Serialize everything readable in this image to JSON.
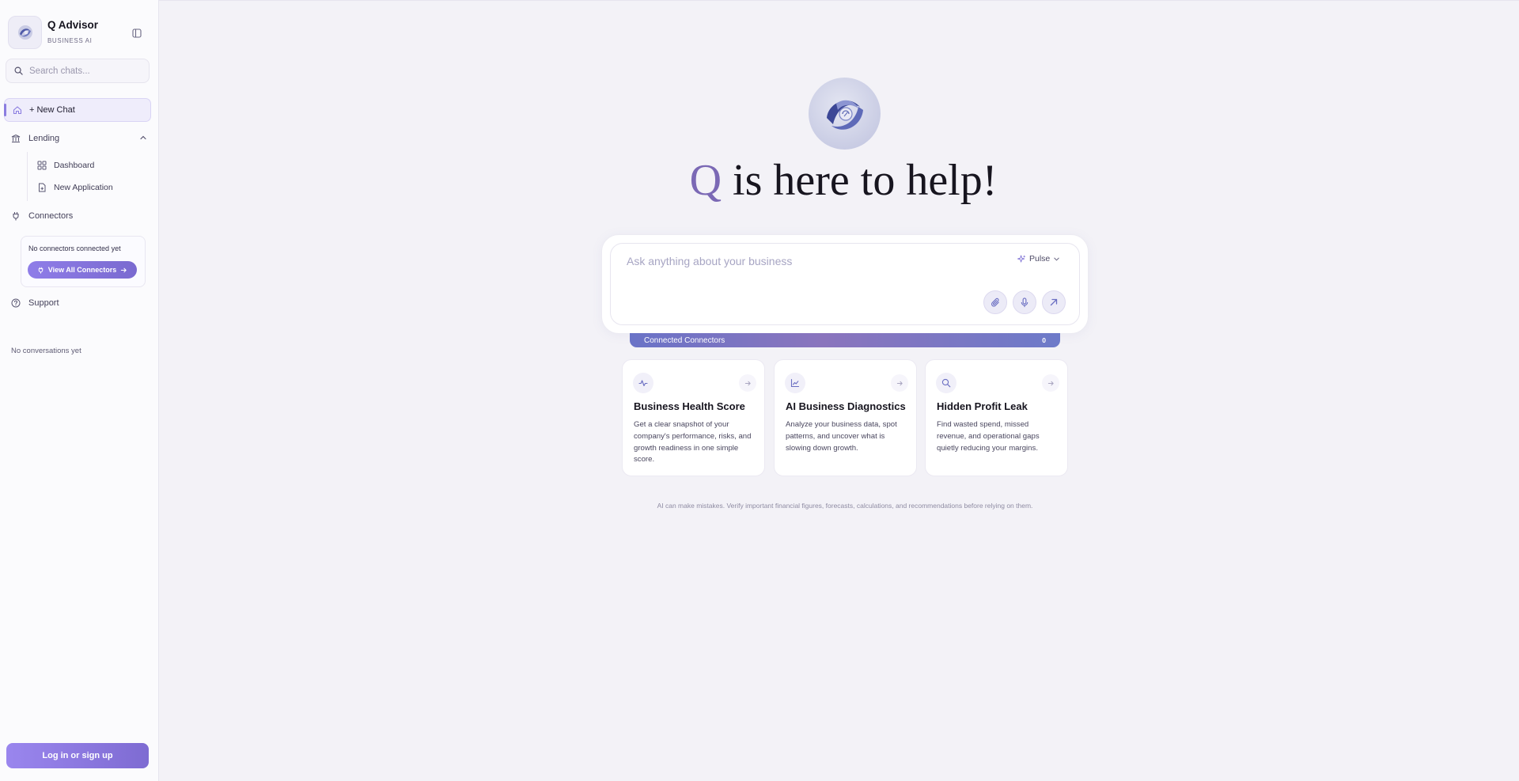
{
  "sidebar": {
    "brand_title": "Q Advisor",
    "brand_subtitle": "BUSINESS AI",
    "search_placeholder": "Search chats...",
    "new_chat": "+ New Chat",
    "lending": "Lending",
    "dashboard": "Dashboard",
    "new_application": "New Application",
    "connectors": "Connectors",
    "connectors_empty": "No connectors connected yet",
    "view_all_connectors": "View All Connectors",
    "support": "Support",
    "no_conversations": "No conversations yet",
    "login": "Log in or sign up"
  },
  "main": {
    "headline_q": "Q",
    "headline_rest": " is here to help!",
    "composer_placeholder": "Ask anything about your business",
    "mode": "Pulse",
    "connected_label": "Connected Connectors",
    "connected_count": "0",
    "cards": [
      {
        "title": "Business Health Score",
        "desc": "Get a clear snapshot of your company's performance, risks, and growth readiness in one simple score."
      },
      {
        "title": "AI Business Diagnostics",
        "desc": "Analyze your business data, spot patterns, and uncover what is slowing down growth."
      },
      {
        "title": "Hidden Profit Leak",
        "desc": "Find wasted spend, missed revenue, and operational gaps quietly reducing your margins."
      }
    ],
    "disclaimer": "AI can make mistakes. Verify important financial figures, forecasts, calculations, and recommendations before relying on them."
  },
  "colors": {
    "accent": "#8b7de0",
    "q_letter": "#7b69b5",
    "background": "#f3f2f7"
  },
  "icons": {
    "collapse": "sidebar-collapse-icon",
    "search": "search-icon",
    "home": "home-icon",
    "bank": "bank-icon",
    "grid": "grid-icon",
    "file": "file-icon",
    "plug": "plug-icon",
    "help": "help-circle-icon",
    "sparkle": "sparkle-icon",
    "paperclip": "paperclip-icon",
    "mic": "mic-icon",
    "send": "arrow-up-right-icon"
  }
}
